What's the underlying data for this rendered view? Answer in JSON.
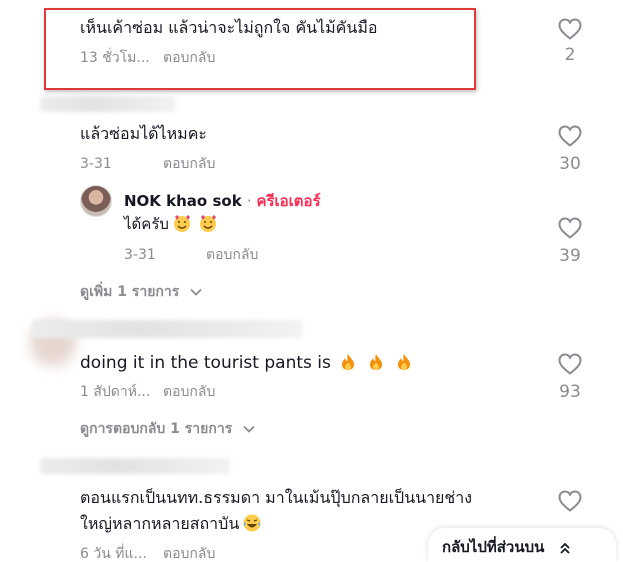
{
  "comments": [
    {
      "text": "เห็นเค้าซ่อม แล้วน่าจะไม่ถูกใจ คันไม้คันมือ",
      "time": "13 ชั่วโม...",
      "reply": "ตอบกลับ",
      "likes": "2"
    },
    {
      "text": "แล้วซ่อมได้ไหมคะ",
      "time": "3-31",
      "reply": "ตอบกลับ",
      "likes": "30"
    },
    {
      "author": "NOK khao sok",
      "badge": "ครีเอเตอร์",
      "text": "ได้ครับ",
      "time": "3-31",
      "reply": "ตอบกลับ",
      "likes": "39"
    },
    {
      "text": "doing it in the tourist pants is",
      "time": "1 สัปดาห์...",
      "reply": "ตอบกลับ",
      "likes": "93"
    },
    {
      "text_line1": "ตอนแรกเป็นนทท.ธรรมดา มาในเม้นปุ๊บกลายเป็นนายช่าง",
      "text_line2": "ใหญ่หลากหลายสถาบัน",
      "time": "6 วัน ที่แ...",
      "reply": "ตอบกลับ"
    }
  ],
  "view_more": "ดูเพิ่ม 1 รายการ",
  "view_replies": "ดูการตอบกลับ 1 รายการ",
  "back_to_top": "กลับไปที่ส่วนบน",
  "colors": {
    "highlight": "#e0393b",
    "creator": "#fe2c55",
    "muted": "#8a8b91",
    "text": "#161823"
  },
  "icons": [
    "heart-icon",
    "chevron-down-icon",
    "double-chevron-up-icon",
    "fire-emoji-icon",
    "smiling-hearts-emoji-icon",
    "laughing-emoji-icon"
  ]
}
